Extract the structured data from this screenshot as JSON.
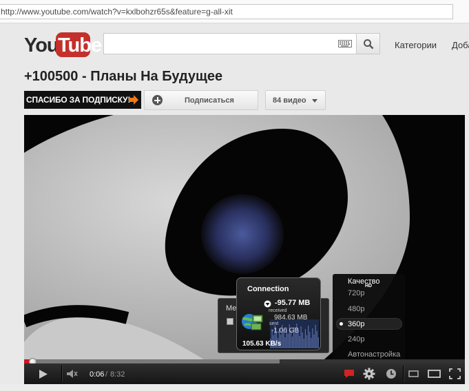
{
  "browser": {
    "url": "http://www.youtube.com/watch?v=kxlbohzr65s&feature=g-all-xit"
  },
  "header": {
    "logo_you": "You",
    "logo_tube": "Tube",
    "search_placeholder": "",
    "nav_categories": "Категории",
    "nav_add": "Доба"
  },
  "video": {
    "title": "+100500 - Планы На Будущее",
    "channel_banner": "СПАСИБО ЗА ПОДПИСКУ!",
    "subscribe_label": "Подписаться",
    "videos_count_label": "84 видео"
  },
  "settings_menu": {
    "title": "Качество",
    "hd_badge": "HD",
    "items": [
      {
        "label": "720p",
        "selected": false
      },
      {
        "label": "480p",
        "selected": false
      },
      {
        "label": "360p",
        "selected": true
      },
      {
        "label": "240p",
        "selected": false
      },
      {
        "label": "Автонастройка",
        "selected": false
      }
    ]
  },
  "annotations_panel": {
    "label": "Ме"
  },
  "connection_widget": {
    "title": "Connection",
    "download": "-95.77 MB",
    "received_label": "received",
    "received": "984.63 MB",
    "sent_label": "sent",
    "sent": "-1.06 GB",
    "speed": "105.63 KB/s"
  },
  "player": {
    "time_current": "0:06",
    "time_separator": "/",
    "time_total": "8:32",
    "played_fraction": 0.012,
    "buffered_fraction": 0.58
  },
  "colors": {
    "accent_red": "#cc181e",
    "logo_red": "#c4302b"
  },
  "icons": {
    "play": "play-icon",
    "volume": "volume-icon",
    "captions": "captions-icon",
    "settings": "gear-icon",
    "watch_later": "clock-icon",
    "size_small": "small-player-icon",
    "size_large": "large-player-icon",
    "fullscreen": "fullscreen-icon"
  }
}
